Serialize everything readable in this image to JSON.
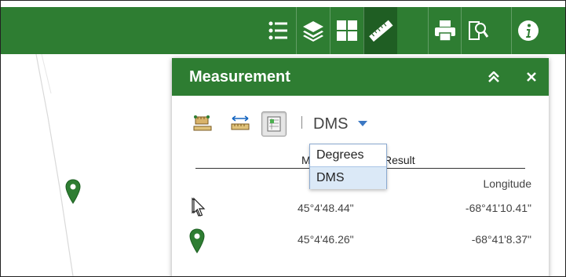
{
  "toolbar": {
    "buttons": [
      {
        "name": "legend-list-icon"
      },
      {
        "name": "layers-icon"
      },
      {
        "name": "basemap-grid-icon"
      },
      {
        "name": "ruler-icon",
        "active": true
      },
      {
        "name": "print-icon"
      },
      {
        "name": "search-document-icon"
      },
      {
        "name": "info-icon"
      }
    ],
    "colors": {
      "bar": "#2e7d32",
      "active": "#1f5e23"
    }
  },
  "panel": {
    "title": "Measurement",
    "unit_selected": "DMS",
    "dropdown_options": [
      "Degrees",
      "DMS"
    ],
    "table": {
      "col_measure": "M",
      "col_result": "Result",
      "lon_header": "Longitude",
      "rows": [
        {
          "lat": "45°4'48.44\"",
          "lon": "-68°41'10.41\"",
          "icon": "cursor-icon"
        },
        {
          "lat": "45°4'46.26\"",
          "lon": "-68°41'8.37\"",
          "icon": "map-pin-icon"
        }
      ]
    }
  }
}
